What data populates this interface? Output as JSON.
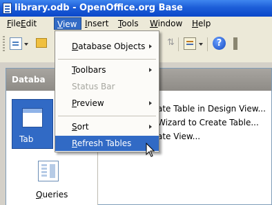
{
  "window": {
    "title": "library.odb - OpenOffice.org Base"
  },
  "menubar": {
    "items": [
      {
        "label": "File"
      },
      {
        "label": "Edit"
      },
      {
        "label": "View"
      },
      {
        "label": "Insert"
      },
      {
        "label": "Tools"
      },
      {
        "label": "Window"
      },
      {
        "label": "Help"
      }
    ]
  },
  "view_menu": {
    "items": [
      {
        "label": "Database Objects",
        "has_submenu": true,
        "enabled": true
      },
      {
        "label": "Toolbars",
        "has_submenu": true,
        "enabled": true
      },
      {
        "label": "Status Bar",
        "has_submenu": false,
        "enabled": false
      },
      {
        "label": "Preview",
        "has_submenu": true,
        "enabled": true
      },
      {
        "label": "Sort",
        "has_submenu": true,
        "enabled": true
      },
      {
        "label": "Refresh Tables",
        "has_submenu": false,
        "enabled": true,
        "highlighted": true
      }
    ]
  },
  "database_panel": {
    "header": "Databa",
    "objects": [
      {
        "label": "Tab",
        "icon": "tables-icon",
        "selected": true
      },
      {
        "label": "Queries",
        "icon": "queries-icon",
        "selected": false
      }
    ]
  },
  "tasks": [
    "ate Table in Design View...",
    "Wizard to Create Table...",
    "ate View..."
  ],
  "colors": {
    "accent": "#316ac5",
    "titlebar": "#0a47c9"
  }
}
